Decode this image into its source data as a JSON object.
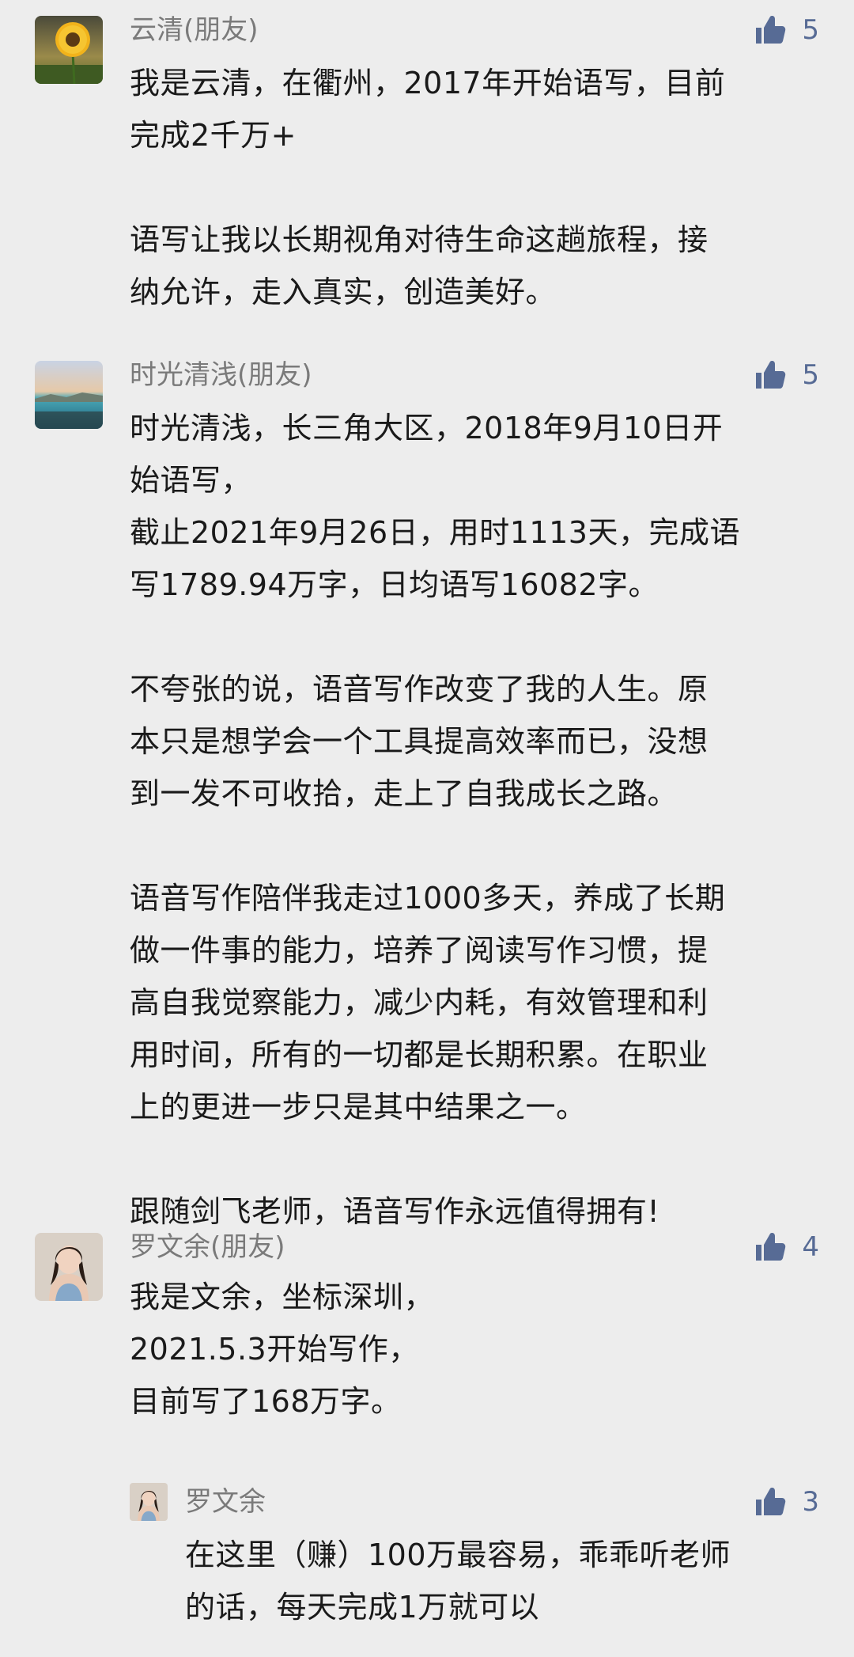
{
  "colors": {
    "background": "#ededed",
    "name": "#7a7a7a",
    "text": "#1a1a1a",
    "like": "#576b95"
  },
  "comments": [
    {
      "name": "云清(朋友)",
      "likes": "5",
      "avatar_icon": "sunflower-avatar",
      "lines": [
        "我是云清，在衢州，2017年开始语写，目前",
        "完成2千万+",
        "",
        "语写让我以长期视角对待生命这趟旅程，接",
        "纳允许，走入真实，创造美好。"
      ]
    },
    {
      "name": "时光清浅(朋友)",
      "likes": "5",
      "avatar_icon": "seascape-avatar",
      "lines": [
        "时光清浅，长三角大区，2018年9月10日开",
        "始语写，",
        "截止2021年9月26日，用时1113天，完成语",
        "写1789.94万字，日均语写16082字。",
        "",
        "不夸张的说，语音写作改变了我的人生。原",
        "本只是想学会一个工具提高效率而已，没想",
        "到一发不可收拾，走上了自我成长之路。",
        "",
        "语音写作陪伴我走过1000多天，养成了长期",
        "做一件事的能力，培养了阅读写作习惯，提",
        "高自我觉察能力，减少内耗，有效管理和利",
        "用时间，所有的一切都是长期积累。在职业",
        "上的更进一步只是其中结果之一。",
        "",
        "跟随剑飞老师，语音写作永远值得拥有!"
      ]
    },
    {
      "name": "罗文余(朋友)",
      "likes": "4",
      "avatar_icon": "portrait-avatar",
      "lines": [
        "我是文余，坐标深圳，",
        "2021.5.3开始写作，",
        "目前写了168万字。"
      ]
    }
  ],
  "reply": {
    "name": "罗文余",
    "likes": "3",
    "avatar_icon": "portrait-avatar-small",
    "lines": [
      "在这里（赚）100万最容易，乖乖听老师",
      "的话，每天完成1万就可以"
    ]
  }
}
